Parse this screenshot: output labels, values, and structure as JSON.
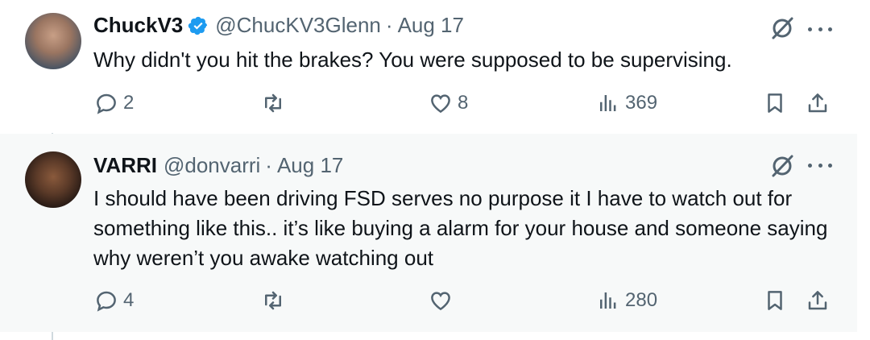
{
  "tweets": [
    {
      "display_name": "ChuckV3",
      "handle": "@ChucKV3Glenn",
      "separator": "·",
      "date": "Aug 17",
      "verified": true,
      "text": "Why didn't you hit the brakes? You were supposed to be supervising.",
      "replies": "2",
      "retweets": "",
      "likes": "8",
      "views": "369"
    },
    {
      "display_name": "VARRI",
      "handle": "@donvarri",
      "separator": "·",
      "date": "Aug 17",
      "verified": false,
      "text": "I should have been driving FSD serves no purpose it I have to watch out for something like this.. it’s like buying a alarm for your house and someone saying why weren’t you awake watching out",
      "replies": "4",
      "retweets": "",
      "likes": "",
      "views": "280"
    }
  ],
  "colors": {
    "text": "#0f1419",
    "secondary": "#536471",
    "verified": "#1d9bf0",
    "thread_line": "#cfd9de",
    "highlight_bg": "#f7f9f9"
  },
  "icons": [
    "reply-icon",
    "retweet-icon",
    "like-icon",
    "views-icon",
    "bookmark-icon",
    "share-icon",
    "grok-icon",
    "more-icon",
    "verified-icon"
  ]
}
